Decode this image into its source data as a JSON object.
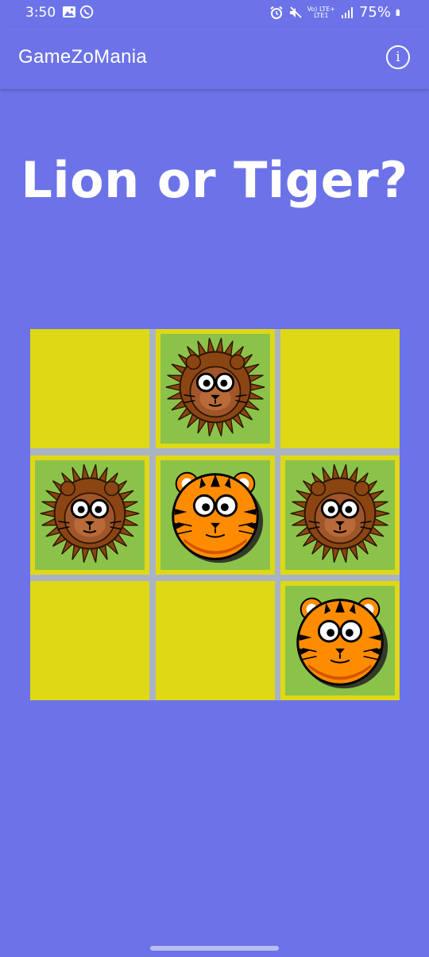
{
  "status_bar": {
    "time": "3:50",
    "network_top": "Vo) LTE+",
    "network_bottom": "LTE1",
    "battery": "75%"
  },
  "app_bar": {
    "title": "GameZoMania",
    "info_icon": "info-icon"
  },
  "game": {
    "heading": "Lion or Tiger?",
    "board": [
      [
        "",
        "lion",
        ""
      ],
      [
        "lion",
        "tiger",
        "lion"
      ],
      [
        "",
        "",
        "tiger"
      ]
    ]
  },
  "colors": {
    "background": "#6c73e8",
    "cell_empty": "#dfd814",
    "cell_filled": "#8bc34a",
    "grid_lines": "#aab3c4"
  }
}
